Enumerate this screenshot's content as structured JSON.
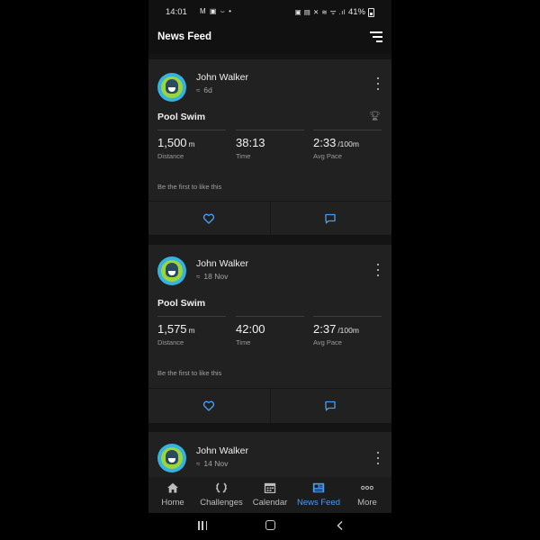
{
  "status_bar": {
    "time": "14:01",
    "left_icons": "M ▣ ⌣ •",
    "right_icons": "▣ ▤ ✕ ≋ ᯤ .ıl",
    "battery": "41%"
  },
  "app_bar": {
    "title": "News Feed",
    "filter_icon": "filter-icon"
  },
  "feed": [
    {
      "user": "John Walker",
      "meta": "6d",
      "meta_icon": "swim-icon",
      "activity_title": "Pool Swim",
      "trophy_icon": "trophy-icon",
      "stats": [
        {
          "value": "1,500",
          "unit": "m",
          "label": "Distance"
        },
        {
          "value": "38:13",
          "unit": "",
          "label": "Time"
        },
        {
          "value": "2:33",
          "unit": "/100m",
          "label": "Avg Pace"
        }
      ],
      "like_hint": "Be the first to like this"
    },
    {
      "user": "John Walker",
      "meta": "18 Nov",
      "meta_icon": "swim-icon",
      "activity_title": "Pool Swim",
      "stats": [
        {
          "value": "1,575",
          "unit": "m",
          "label": "Distance"
        },
        {
          "value": "42:00",
          "unit": "",
          "label": "Time"
        },
        {
          "value": "2:37",
          "unit": "/100m",
          "label": "Avg Pace"
        }
      ],
      "like_hint": "Be the first to like this"
    },
    {
      "user": "John Walker",
      "meta": "14 Nov",
      "meta_icon": "swim-icon"
    }
  ],
  "bottom_nav": [
    {
      "label": "Home",
      "icon": "home-icon",
      "active": false
    },
    {
      "label": "Challenges",
      "icon": "laurel-icon",
      "active": false
    },
    {
      "label": "Calendar",
      "icon": "calendar-icon",
      "active": false
    },
    {
      "label": "News Feed",
      "icon": "newspaper-icon",
      "active": true
    },
    {
      "label": "More",
      "icon": "more-icon",
      "active": false
    }
  ],
  "colors": {
    "accent": "#4a9bf0",
    "background": "#111111",
    "card": "#212121"
  }
}
